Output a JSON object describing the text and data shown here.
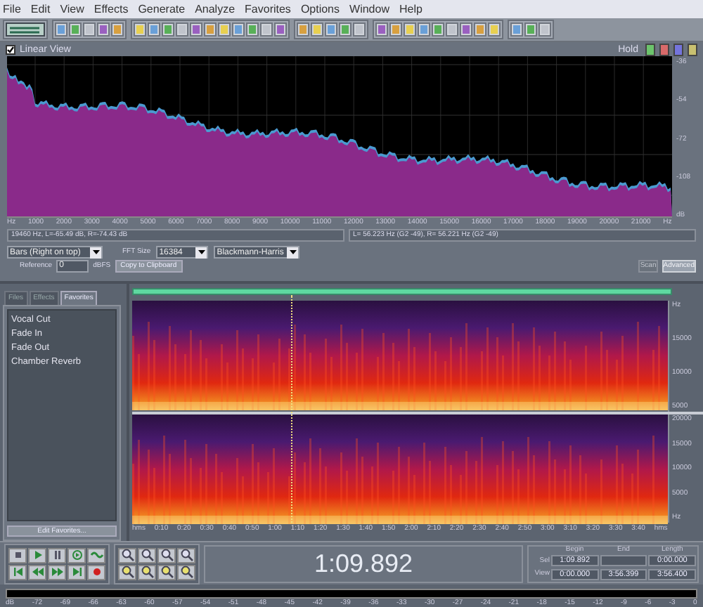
{
  "menu": [
    "File",
    "Edit",
    "View",
    "Effects",
    "Generate",
    "Analyze",
    "Favorites",
    "Options",
    "Window",
    "Help"
  ],
  "frequency_analysis": {
    "linear_view": {
      "label": "Linear View",
      "checked": true
    },
    "hold_label": "Hold",
    "hold_buttons": [
      {
        "color": "#6cc46c"
      },
      {
        "color": "#d86a6a"
      },
      {
        "color": "#7474dc"
      },
      {
        "color": "#c8c070"
      }
    ],
    "x_axis": [
      "Hz",
      "1000",
      "2000",
      "3000",
      "4000",
      "5000",
      "6000",
      "7000",
      "8000",
      "9000",
      "10000",
      "11000",
      "12000",
      "13000",
      "14000",
      "15000",
      "16000",
      "17000",
      "18000",
      "19000",
      "20000",
      "21000",
      "Hz"
    ],
    "y_axis": [
      "-36",
      "-54",
      "-72",
      "-108",
      "dB"
    ],
    "cursor_readout": "19460 Hz, L=-65.49 dB, R=-74.43 dB",
    "peak_readout": "L= 56.223 Hz (G2 -49), R= 56.221 Hz (G2 -49)",
    "graph_type": "Bars (Right on top)",
    "fft_label": "FFT Size",
    "fft_size": "16384",
    "window_function": "Blackmann-Harris",
    "reference_label": "Reference",
    "reference_value": "0",
    "reference_unit": "dBFS",
    "copy_button": "Copy to Clipboard",
    "buttons": [
      {
        "label": "Scan",
        "disabled": true
      },
      {
        "label": "Advanced",
        "disabled": false
      }
    ]
  },
  "organizer": {
    "tabs": [
      {
        "label": "Files",
        "selected": false
      },
      {
        "label": "Effects",
        "selected": false
      },
      {
        "label": "Favorites",
        "selected": true
      }
    ],
    "items": [
      "Vocal Cut",
      "Fade In",
      "Fade Out",
      "Chamber Reverb"
    ],
    "edit_button": "Edit Favorites..."
  },
  "spectral_view": {
    "playhead": {
      "level": 0.296
    },
    "channels": [
      {
        "axis": [
          "Hz",
          "15000",
          "10000",
          "5000"
        ]
      },
      {
        "axis": [
          "20000",
          "15000",
          "10000",
          "5000",
          "Hz"
        ]
      }
    ],
    "time_ruler": [
      "hms",
      "0:10",
      "0:20",
      "0:30",
      "0:40",
      "0:50",
      "1:00",
      "1:10",
      "1:20",
      "1:30",
      "1:40",
      "1:50",
      "2:00",
      "2:10",
      "2:20",
      "2:30",
      "2:40",
      "2:50",
      "3:00",
      "3:10",
      "3:20",
      "3:30",
      "3:40",
      "hms"
    ]
  },
  "time_display": "1:09.892",
  "selection": {
    "headers": [
      "Begin",
      "End",
      "Length"
    ],
    "rows": [
      {
        "label": "Sel",
        "begin": "1:09.892",
        "length": "0:00.000"
      },
      {
        "label": "View",
        "begin": "0:00.000",
        "end": "3:56.399",
        "length": "3:56.400"
      }
    ]
  },
  "level_meter": {
    "scale": [
      "dB",
      "-72",
      "-69",
      "-66",
      "-63",
      "-60",
      "-57",
      "-54",
      "-51",
      "-48",
      "-45",
      "-42",
      "-39",
      "-36",
      "-33",
      "-30",
      "-27",
      "-24",
      "-21",
      "-18",
      "-15",
      "-12",
      "-9",
      "-6",
      "-3",
      "0"
    ]
  }
}
